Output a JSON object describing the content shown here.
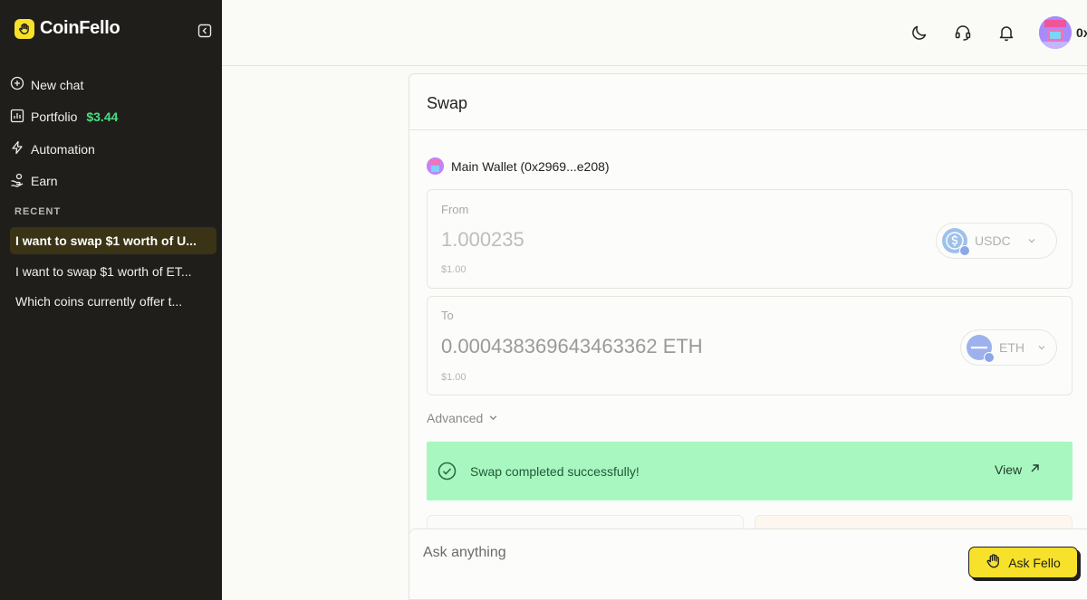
{
  "app": {
    "name": "CoinFello",
    "brand_color": "#f7e12a"
  },
  "sidebar": {
    "nav": [
      {
        "label": "New chat",
        "icon": "plus-circle-icon"
      },
      {
        "label": "Portfolio",
        "icon": "chart-icon",
        "value": "$3.44"
      },
      {
        "label": "Automation",
        "icon": "lightning-icon"
      },
      {
        "label": "Earn",
        "icon": "hand-coins-icon"
      }
    ],
    "recent_heading": "RECENT",
    "recent": [
      {
        "label": "I want to swap $1 worth of U...",
        "active": true
      },
      {
        "label": "I want to swap $1 worth of ET..."
      },
      {
        "label": "Which coins currently offer t..."
      }
    ]
  },
  "topbar": {
    "account_id": "0x"
  },
  "swap": {
    "title": "Swap",
    "wallet": "Main Wallet (0x2969...e208)",
    "from": {
      "label": "From",
      "amount": "1.000235",
      "fiat": "$1.00",
      "token": "USDC"
    },
    "to": {
      "label": "To",
      "amount": "0.000438369643463362 ETH",
      "fiat": "$1.00",
      "token": "ETH"
    },
    "advanced_label": "Advanced",
    "success": {
      "message": "Swap completed successfully!",
      "link": "View",
      "color": "#a9f7c0"
    }
  },
  "ask": {
    "placeholder": "Ask anything",
    "button": "Ask Fello"
  }
}
